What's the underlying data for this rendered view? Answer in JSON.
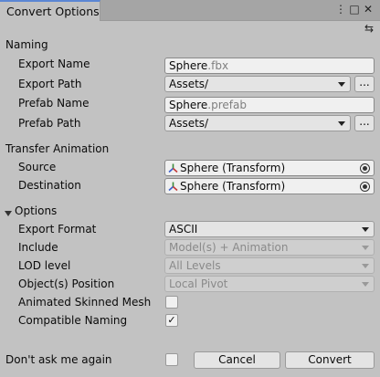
{
  "window": {
    "title": "Convert Options",
    "menu_icon": "⋮",
    "max_icon": "□",
    "close_icon": "✕"
  },
  "toolbar_icon": "⇆",
  "naming": {
    "header": "Naming",
    "export_name_label": "Export Name",
    "export_name_value": "Sphere",
    "export_name_ext": ".fbx",
    "export_path_label": "Export Path",
    "export_path_value": "Assets/",
    "prefab_name_label": "Prefab Name",
    "prefab_name_value": "Sphere",
    "prefab_name_ext": ".prefab",
    "prefab_path_label": "Prefab Path",
    "prefab_path_value": "Assets/",
    "browse_label": "..."
  },
  "transfer": {
    "header": "Transfer Animation",
    "source_label": "Source",
    "source_value": "Sphere (Transform)",
    "destination_label": "Destination",
    "destination_value": "Sphere (Transform)"
  },
  "options": {
    "header": "Options",
    "export_format_label": "Export Format",
    "export_format_value": "ASCII",
    "include_label": "Include",
    "include_value": "Model(s) + Animation",
    "lod_label": "LOD level",
    "lod_value": "All Levels",
    "position_label": "Object(s) Position",
    "position_value": "Local Pivot",
    "skinned_label": "Animated Skinned Mesh",
    "skinned_checked": false,
    "compat_label": "Compatible Naming",
    "compat_checked": true,
    "check_mark": "✓"
  },
  "footer": {
    "dont_ask_label": "Don't ask me again",
    "cancel_label": "Cancel",
    "convert_label": "Convert"
  }
}
